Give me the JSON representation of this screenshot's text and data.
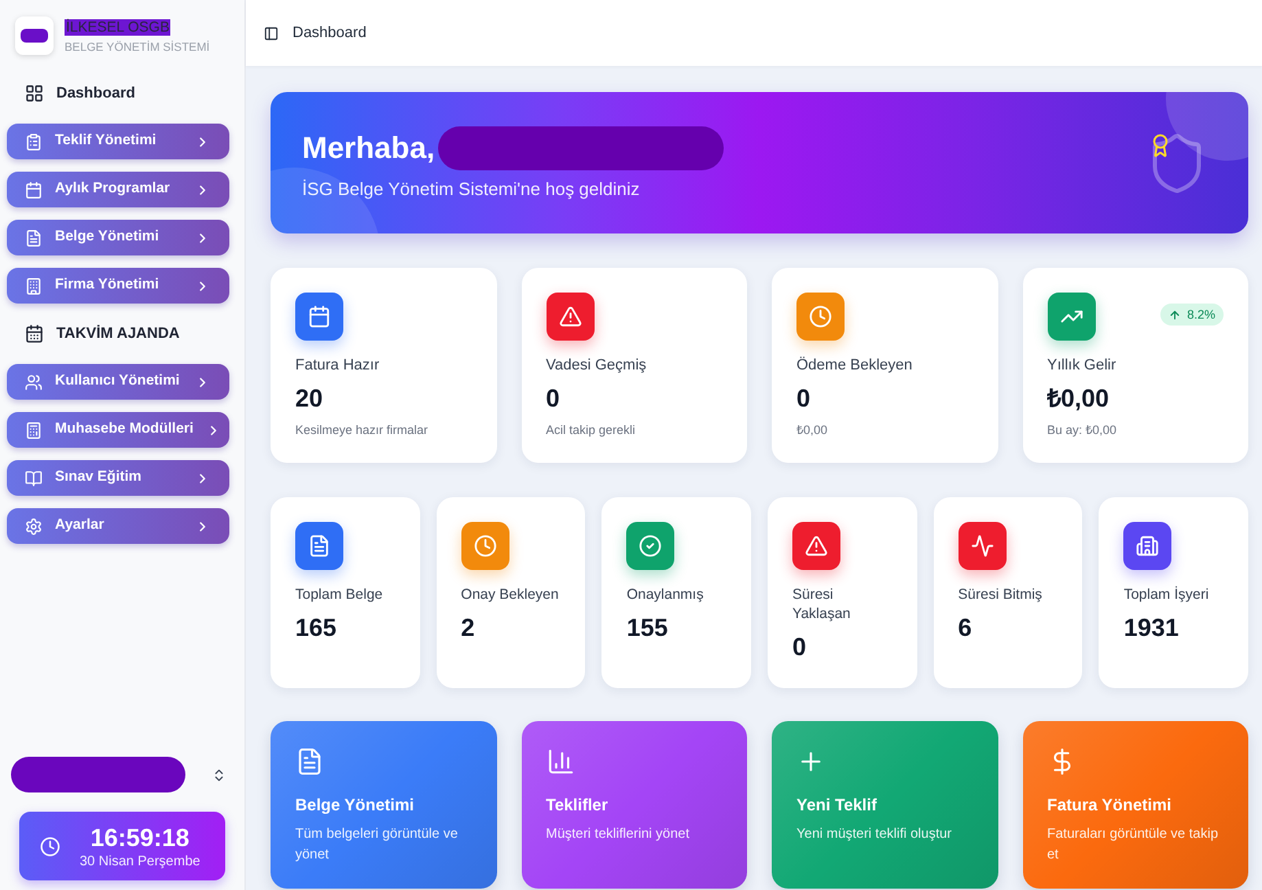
{
  "sidebar": {
    "brand": {
      "name": "İLKESEL OSGB",
      "subtitle": "BELGE YÖNETİM SİSTEMİ"
    },
    "items": [
      {
        "label": "Dashboard",
        "kind": "link"
      },
      {
        "label": "Teklif Yönetimi",
        "kind": "menu",
        "expanded": false
      },
      {
        "label": "Aylık Programlar",
        "kind": "menu",
        "expanded": false
      },
      {
        "label": "Belge Yönetimi",
        "kind": "menu",
        "expanded": false
      },
      {
        "label": "Firma Yönetimi",
        "kind": "menu",
        "expanded": false
      },
      {
        "label": "TAKVİM AJANDA",
        "kind": "link"
      },
      {
        "label": "Kullanıcı Yönetimi",
        "kind": "menu",
        "expanded": false
      },
      {
        "label": "Muhasebe Modülleri",
        "kind": "menu",
        "expanded": false
      },
      {
        "label": "Sınav Eğitim",
        "kind": "menu",
        "expanded": false
      },
      {
        "label": "Ayarlar",
        "kind": "menu",
        "expanded": false
      }
    ],
    "clock": {
      "time": "16:59:18",
      "date": "30 Nisan Perşembe"
    }
  },
  "header": {
    "title": "Dashboard"
  },
  "hero": {
    "greeting": "Merhaba,",
    "subtitle": "İSG Belge Yönetim Sistemi'ne hoş geldiniz"
  },
  "summary_cards": [
    {
      "label": "Fatura Hazır",
      "value": "20",
      "note": "Kesilmeye hazır firmalar",
      "color": "#2f6ef5"
    },
    {
      "label": "Vadesi Geçmiş",
      "value": "0",
      "note": "Acil takip gerekli",
      "color": "#ee1d2e"
    },
    {
      "label": "Ödeme Bekleyen",
      "value": "0",
      "note": "₺0,00",
      "color": "#f28a0c"
    },
    {
      "label": "Yıllık Gelir",
      "value": "₺0,00",
      "note": "Bu ay: ₺0,00",
      "color": "#0fa36c",
      "trend": "8.2%"
    }
  ],
  "stat_cards": [
    {
      "label": "Toplam Belge",
      "value": "165",
      "color": "#2f6ef5"
    },
    {
      "label": "Onay Bekleyen",
      "value": "2",
      "color": "#f28a0c"
    },
    {
      "label": "Onaylanmış",
      "value": "155",
      "color": "#0fa36c"
    },
    {
      "label": "Süresi Yaklaşan",
      "value": "0",
      "color": "#ee1d2e"
    },
    {
      "label": "Süresi Bitmiş",
      "value": "6",
      "color": "#ee1d2e"
    },
    {
      "label": "Toplam İşyeri",
      "value": "1931",
      "color": "#5b47f2"
    }
  ],
  "action_cards": [
    {
      "title": "Belge Yönetimi",
      "description": "Tüm belgeleri görüntüle ve yönet",
      "color": "#3b7cf8"
    },
    {
      "title": "Teklifler",
      "description": "Müşteri tekliflerini yönet",
      "color": "#a445f6"
    },
    {
      "title": "Yeni Teklif",
      "description": "Yeni müşteri teklifi oluştur",
      "color": "#12a874"
    },
    {
      "title": "Fatura Yönetimi",
      "description": "Faturaları görüntüle ve takip et",
      "color": "#fb6a0e"
    }
  ]
}
